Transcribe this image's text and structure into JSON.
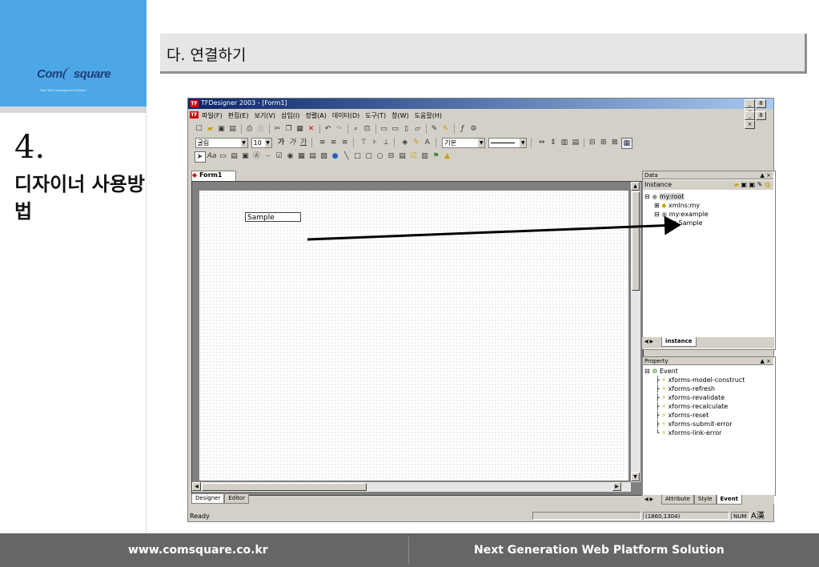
{
  "slide": {
    "logo_text_left": "Com",
    "logo_text_right": "square",
    "logo_tagline": "Next Web Development Solution",
    "section_number": "4.",
    "section_title": "디자이너 사용방법",
    "heading": "다. 연결하기",
    "footer_left": "www.comsquare.co.kr",
    "footer_right": "Next Generation Web Platform Solution",
    "accent_color": "#4da7e6"
  },
  "app": {
    "icon": "TF",
    "title": "TFDesigner 2003 - [Form1]",
    "window_buttons": [
      "_",
      "8",
      "×"
    ],
    "menu": [
      "파일(F)",
      "편집(E)",
      "보기(V)",
      "삽입(I)",
      "정렬(A)",
      "데이터(D)",
      "도구(T)",
      "창(W)",
      "도움말(H)"
    ],
    "toolbar1_icons": [
      "new-icon",
      "open-icon",
      "save-icon",
      "save-all-icon",
      "print-icon",
      "preview-icon",
      "cut-icon",
      "copy-icon",
      "paste-icon",
      "delete-icon",
      "undo-icon",
      "redo-icon",
      "find-icon",
      "zoom-icon",
      "view1-icon",
      "view2-icon",
      "view3-icon",
      "view4-icon",
      "pen-icon",
      "pen2-icon",
      "fx-icon",
      "settings-icon"
    ],
    "font_name": "굴림",
    "font_size": "10",
    "format_buttons": [
      "가",
      "가",
      "가"
    ],
    "line_style_label": "기본",
    "doc_tab": "Form1",
    "sample_field_value": "Sample",
    "bottom_tabs": [
      "Designer",
      "Editor"
    ],
    "data_panel": {
      "title": "Data",
      "instance_label": "Instance",
      "tree": [
        "my:root",
        "xmlns:my",
        "my:example",
        "Sample"
      ],
      "tab": "instance"
    },
    "property_panel": {
      "title": "Property",
      "root": "Event",
      "events": [
        "xforms-model-construct",
        "xforms-refresh",
        "xforms-revalidate",
        "xforms-recalculate",
        "xforms-reset",
        "xforms-submit-error",
        "xforms-link-error"
      ],
      "tabs": [
        "Attribute",
        "Style",
        "Event"
      ]
    },
    "status": {
      "text": "Ready",
      "coords": "(1860,1304)",
      "num": "NUM",
      "ime": "A漢"
    }
  }
}
